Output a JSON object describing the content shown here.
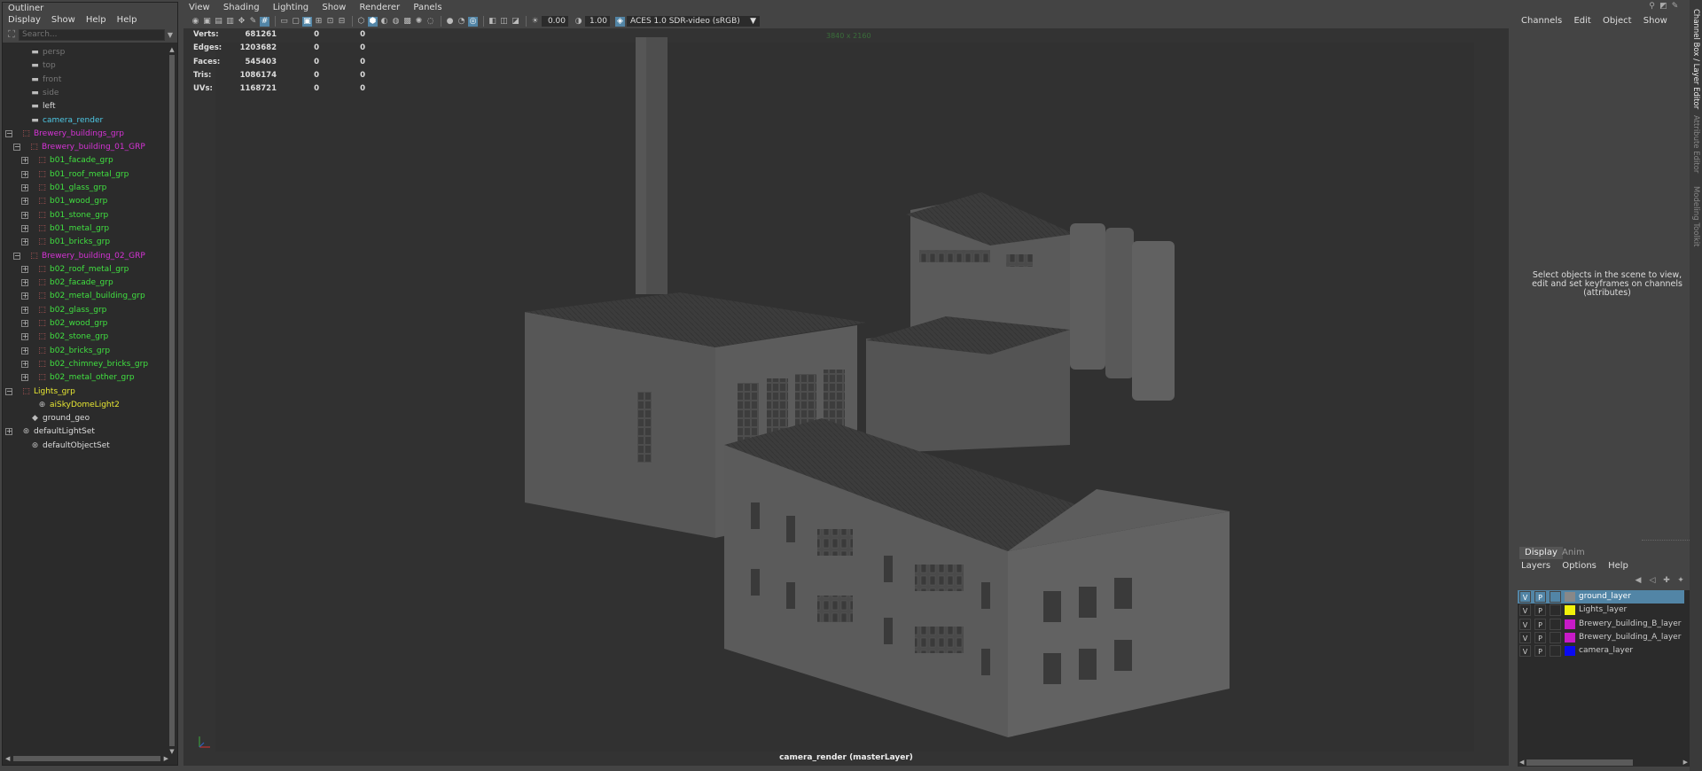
{
  "outliner": {
    "title": "Outliner",
    "menu": [
      "Display",
      "Show",
      "Help",
      "Help"
    ],
    "search_placeholder": "Search...",
    "items": [
      {
        "label": "persp",
        "color": "#777777",
        "icon": "camera-icon"
      },
      {
        "label": "top",
        "color": "#777777",
        "icon": "camera-icon"
      },
      {
        "label": "front",
        "color": "#777777",
        "icon": "camera-icon"
      },
      {
        "label": "side",
        "color": "#777777",
        "icon": "camera-icon"
      },
      {
        "label": "left",
        "color": "#dddddd",
        "icon": "camera-icon"
      },
      {
        "label": "camera_render",
        "color": "#4ec9e6",
        "icon": "camera-icon"
      },
      {
        "label": "Brewery_buildings_grp",
        "color": "#d633d6",
        "icon": "group-icon"
      },
      {
        "label": "Brewery_building_01_GRP",
        "color": "#d633d6",
        "icon": "group-icon"
      },
      {
        "label": "b01_facade_grp",
        "color": "#40e040",
        "icon": "group-icon"
      },
      {
        "label": "b01_roof_metal_grp",
        "color": "#40e040",
        "icon": "group-icon"
      },
      {
        "label": "b01_glass_grp",
        "color": "#40e040",
        "icon": "group-icon"
      },
      {
        "label": "b01_wood_grp",
        "color": "#40e040",
        "icon": "group-icon"
      },
      {
        "label": "b01_stone_grp",
        "color": "#40e040",
        "icon": "group-icon"
      },
      {
        "label": "b01_metal_grp",
        "color": "#40e040",
        "icon": "group-icon"
      },
      {
        "label": "b01_bricks_grp",
        "color": "#40e040",
        "icon": "group-icon"
      },
      {
        "label": "Brewery_building_02_GRP",
        "color": "#d633d6",
        "icon": "group-icon"
      },
      {
        "label": "b02_roof_metal_grp",
        "color": "#40e040",
        "icon": "group-icon"
      },
      {
        "label": "b02_facade_grp",
        "color": "#40e040",
        "icon": "group-icon"
      },
      {
        "label": "b02_metal_building_grp",
        "color": "#40e040",
        "icon": "group-icon"
      },
      {
        "label": "b02_glass_grp",
        "color": "#40e040",
        "icon": "group-icon"
      },
      {
        "label": "b02_wood_grp",
        "color": "#40e040",
        "icon": "group-icon"
      },
      {
        "label": "b02_stone_grp",
        "color": "#40e040",
        "icon": "group-icon"
      },
      {
        "label": "b02_bricks_grp",
        "color": "#40e040",
        "icon": "group-icon"
      },
      {
        "label": "b02_chimney_bricks_grp",
        "color": "#40e040",
        "icon": "group-icon"
      },
      {
        "label": "b02_metal_other_grp",
        "color": "#40e040",
        "icon": "group-icon"
      },
      {
        "label": "Lights_grp",
        "color": "#e6e633",
        "icon": "group-icon"
      },
      {
        "label": "aiSkyDomeLight2",
        "color": "#e6e633",
        "icon": "skydome-light-icon"
      },
      {
        "label": "ground_geo",
        "color": "#dddddd",
        "icon": "mesh-icon"
      },
      {
        "label": "defaultLightSet",
        "color": "#dddddd",
        "icon": "set-icon"
      },
      {
        "label": "defaultObjectSet",
        "color": "#dddddd",
        "icon": "set-icon"
      }
    ]
  },
  "viewport": {
    "menu": [
      "View",
      "Shading",
      "Lighting",
      "Show",
      "Renderer",
      "Panels"
    ],
    "exposure": "0.00",
    "gamma": "1.00",
    "color_transform": "ACES 1.0 SDR-video (sRGB)",
    "resolution": "3840 x 2160",
    "camera_label": "camera_render (masterLayer)",
    "hud": [
      {
        "key": "Verts:",
        "v1": "681261",
        "v2": "0",
        "v3": "0"
      },
      {
        "key": "Edges:",
        "v1": "1203682",
        "v2": "0",
        "v3": "0"
      },
      {
        "key": "Faces:",
        "v1": "545403",
        "v2": "0",
        "v3": "0"
      },
      {
        "key": "Tris:",
        "v1": "1086174",
        "v2": "0",
        "v3": "0"
      },
      {
        "key": "UVs:",
        "v1": "1168721",
        "v2": "0",
        "v3": "0"
      }
    ]
  },
  "channel_box": {
    "menu": [
      "Channels",
      "Edit",
      "Object",
      "Show"
    ],
    "empty_message": "Select objects in the scene to view, edit and set keyframes on channels (attributes)"
  },
  "layer_editor": {
    "tabs": [
      "Display",
      "Anim"
    ],
    "menu": [
      "Layers",
      "Options",
      "Help"
    ],
    "layers": [
      {
        "name": "ground_layer",
        "v": "V",
        "p": "P",
        "color": "#888888",
        "selected": true
      },
      {
        "name": "Lights_layer",
        "v": "V",
        "p": "P",
        "color": "#f2f20a",
        "selected": false
      },
      {
        "name": "Brewery_building_B_layer",
        "v": "V",
        "p": "P",
        "color": "#c71ac7",
        "selected": false
      },
      {
        "name": "Brewery_building_A_layer",
        "v": "V",
        "p": "P",
        "color": "#c71ac7",
        "selected": false
      },
      {
        "name": "camera_layer",
        "v": "V",
        "p": "P",
        "color": "#0a0af2",
        "selected": false
      }
    ]
  },
  "side_tabs": [
    "Channel Box / Layer Editor",
    "Attribute Editor",
    "Modeling Toolkit"
  ]
}
